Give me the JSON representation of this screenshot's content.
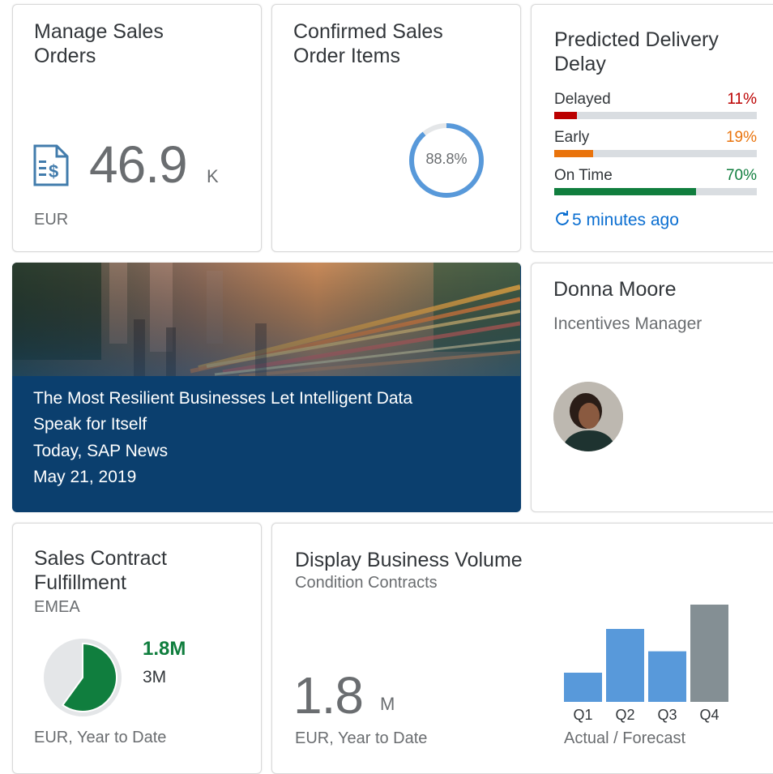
{
  "tiles": {
    "manage_sales_orders": {
      "title": "Manage Sales Orders",
      "value": "46.9",
      "unit": "K",
      "footer": "EUR",
      "icon": "sales-order-document-icon"
    },
    "confirmed_items": {
      "title": "Confirmed Sales Order Items",
      "value_label": "88.8%",
      "progress": 88.8,
      "color": "#5899da"
    },
    "delivery_delay": {
      "title": "Predicted Delivery Delay",
      "rows": [
        {
          "label": "Delayed",
          "pct_label": "11%",
          "value": 11,
          "color": "#bb0000"
        },
        {
          "label": "Early",
          "pct_label": "19%",
          "value": 19,
          "color": "#e9730c"
        },
        {
          "label": "On Time",
          "pct_label": "70%",
          "value": 70,
          "color": "#107e3e"
        }
      ],
      "refresh": "5 minutes ago",
      "refresh_icon": "refresh-icon",
      "refresh_color": "#0a6ed1"
    },
    "news": {
      "line1": "The Most Resilient Businesses Let Intelligent Data",
      "line2": "Speak for Itself",
      "source": "Today, SAP News",
      "date": "May 21, 2019"
    },
    "contact": {
      "name": "Donna Moore",
      "role": "Incentives Manager",
      "avatar_icon": "person-avatar"
    },
    "contract_fulfillment": {
      "title": "Sales Contract Fulfillment",
      "subtitle": "EMEA",
      "actual": "1.8M",
      "target": "3M",
      "fraction": 0.6,
      "actual_color": "#107e3e",
      "footer": "EUR, Year to Date"
    },
    "business_volume": {
      "title": "Display Business Volume",
      "subtitle": "Condition Contracts",
      "value": "1.8",
      "unit": "M",
      "footer": "EUR, Year to Date",
      "chart_footer": "Actual / Forecast"
    }
  },
  "chart_data": {
    "type": "bar",
    "categories": [
      "Q1",
      "Q2",
      "Q3",
      "Q4"
    ],
    "values": [
      30,
      75,
      52,
      100
    ],
    "ylim": [
      0,
      100
    ],
    "colors": [
      "#5899da",
      "#5899da",
      "#5899da",
      "#848f94"
    ]
  }
}
